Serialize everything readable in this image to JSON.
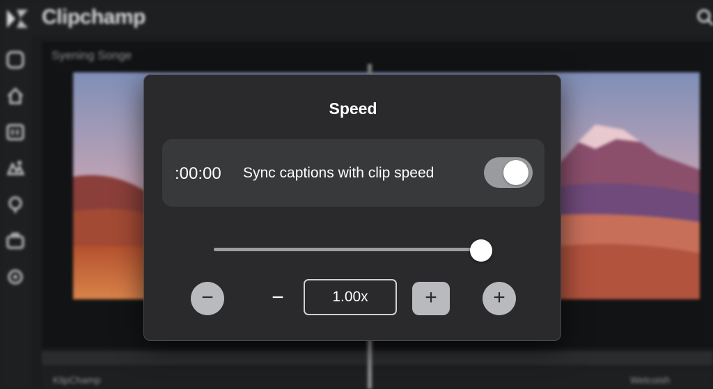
{
  "app": {
    "title": "Clipchamp"
  },
  "editor": {
    "project_name": "Syening Songe"
  },
  "bottom": {
    "left_label": "KlipChamp",
    "right_label": "Wetcoish"
  },
  "icons": {
    "logo": "clipchamp-logo-icon",
    "search": "search-icon",
    "sidebar": [
      "media-icon",
      "home-icon",
      "text-icon",
      "graphics-icon",
      "transitions-icon",
      "brand-kit-icon",
      "settings-icon"
    ]
  },
  "speed_dialog": {
    "title": "Speed",
    "timecode": ":00:00",
    "sync_label": "Sync captions with clip speed",
    "sync_enabled": true,
    "slider_level": 0.99,
    "speed_value": "1.00x",
    "minus_symbol": "−",
    "plus_symbol": "+"
  },
  "colors": {
    "dialog_bg": "#2a2a2c",
    "row_bg": "#38393b",
    "button_bg": "#b9babd",
    "toggle_on": "#9a9b9e"
  }
}
